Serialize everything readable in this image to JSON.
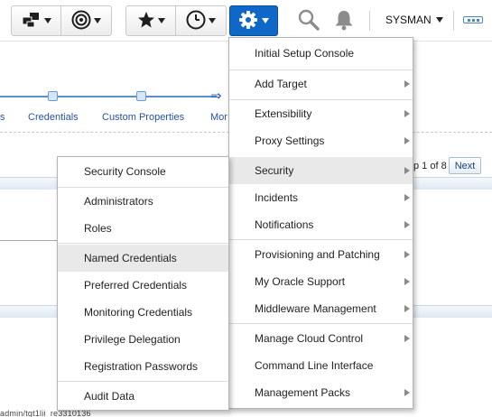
{
  "toolbar": {
    "user_label": "SYSMAN",
    "icons": {
      "targets": "targets-icon",
      "favorites_target": "target-icon",
      "favorites": "star-icon",
      "history": "clock-icon",
      "setup": "gear-icon",
      "search": "search-icon",
      "notifications": "bell-icon",
      "more": "more-icon"
    },
    "accent_color": "#0f67c8"
  },
  "background_page": {
    "train_steps": [
      "s",
      "Credentials",
      "Custom Properties",
      "Mor"
    ],
    "pager": "p 1 of 8",
    "next_label": "Next",
    "status_bar": "admin/tgt1lii_re3310136"
  },
  "setup_menu": {
    "items": [
      {
        "label": "Initial Setup Console",
        "submenu": false
      },
      {
        "label": "Add Target",
        "submenu": true
      },
      {
        "label": "Extensibility",
        "submenu": true
      },
      {
        "label": "Proxy Settings",
        "submenu": true
      },
      {
        "label": "Security",
        "submenu": true
      },
      {
        "label": "Incidents",
        "submenu": true
      },
      {
        "label": "Notifications",
        "submenu": true
      },
      {
        "label": "Provisioning and Patching",
        "submenu": true
      },
      {
        "label": "My Oracle Support",
        "submenu": true
      },
      {
        "label": "Middleware Management",
        "submenu": true
      },
      {
        "label": "Manage Cloud Control",
        "submenu": true
      },
      {
        "label": "Command Line Interface",
        "submenu": false
      },
      {
        "label": "Management Packs",
        "submenu": true
      }
    ],
    "active_item": "Security"
  },
  "security_submenu": {
    "items": [
      {
        "label": "Security Console"
      },
      {
        "label": "Administrators"
      },
      {
        "label": "Roles"
      },
      {
        "label": "Named Credentials"
      },
      {
        "label": "Preferred Credentials"
      },
      {
        "label": "Monitoring Credentials"
      },
      {
        "label": "Privilege Delegation"
      },
      {
        "label": "Registration Passwords"
      },
      {
        "label": "Audit Data"
      }
    ],
    "highlighted_item": "Named Credentials"
  }
}
